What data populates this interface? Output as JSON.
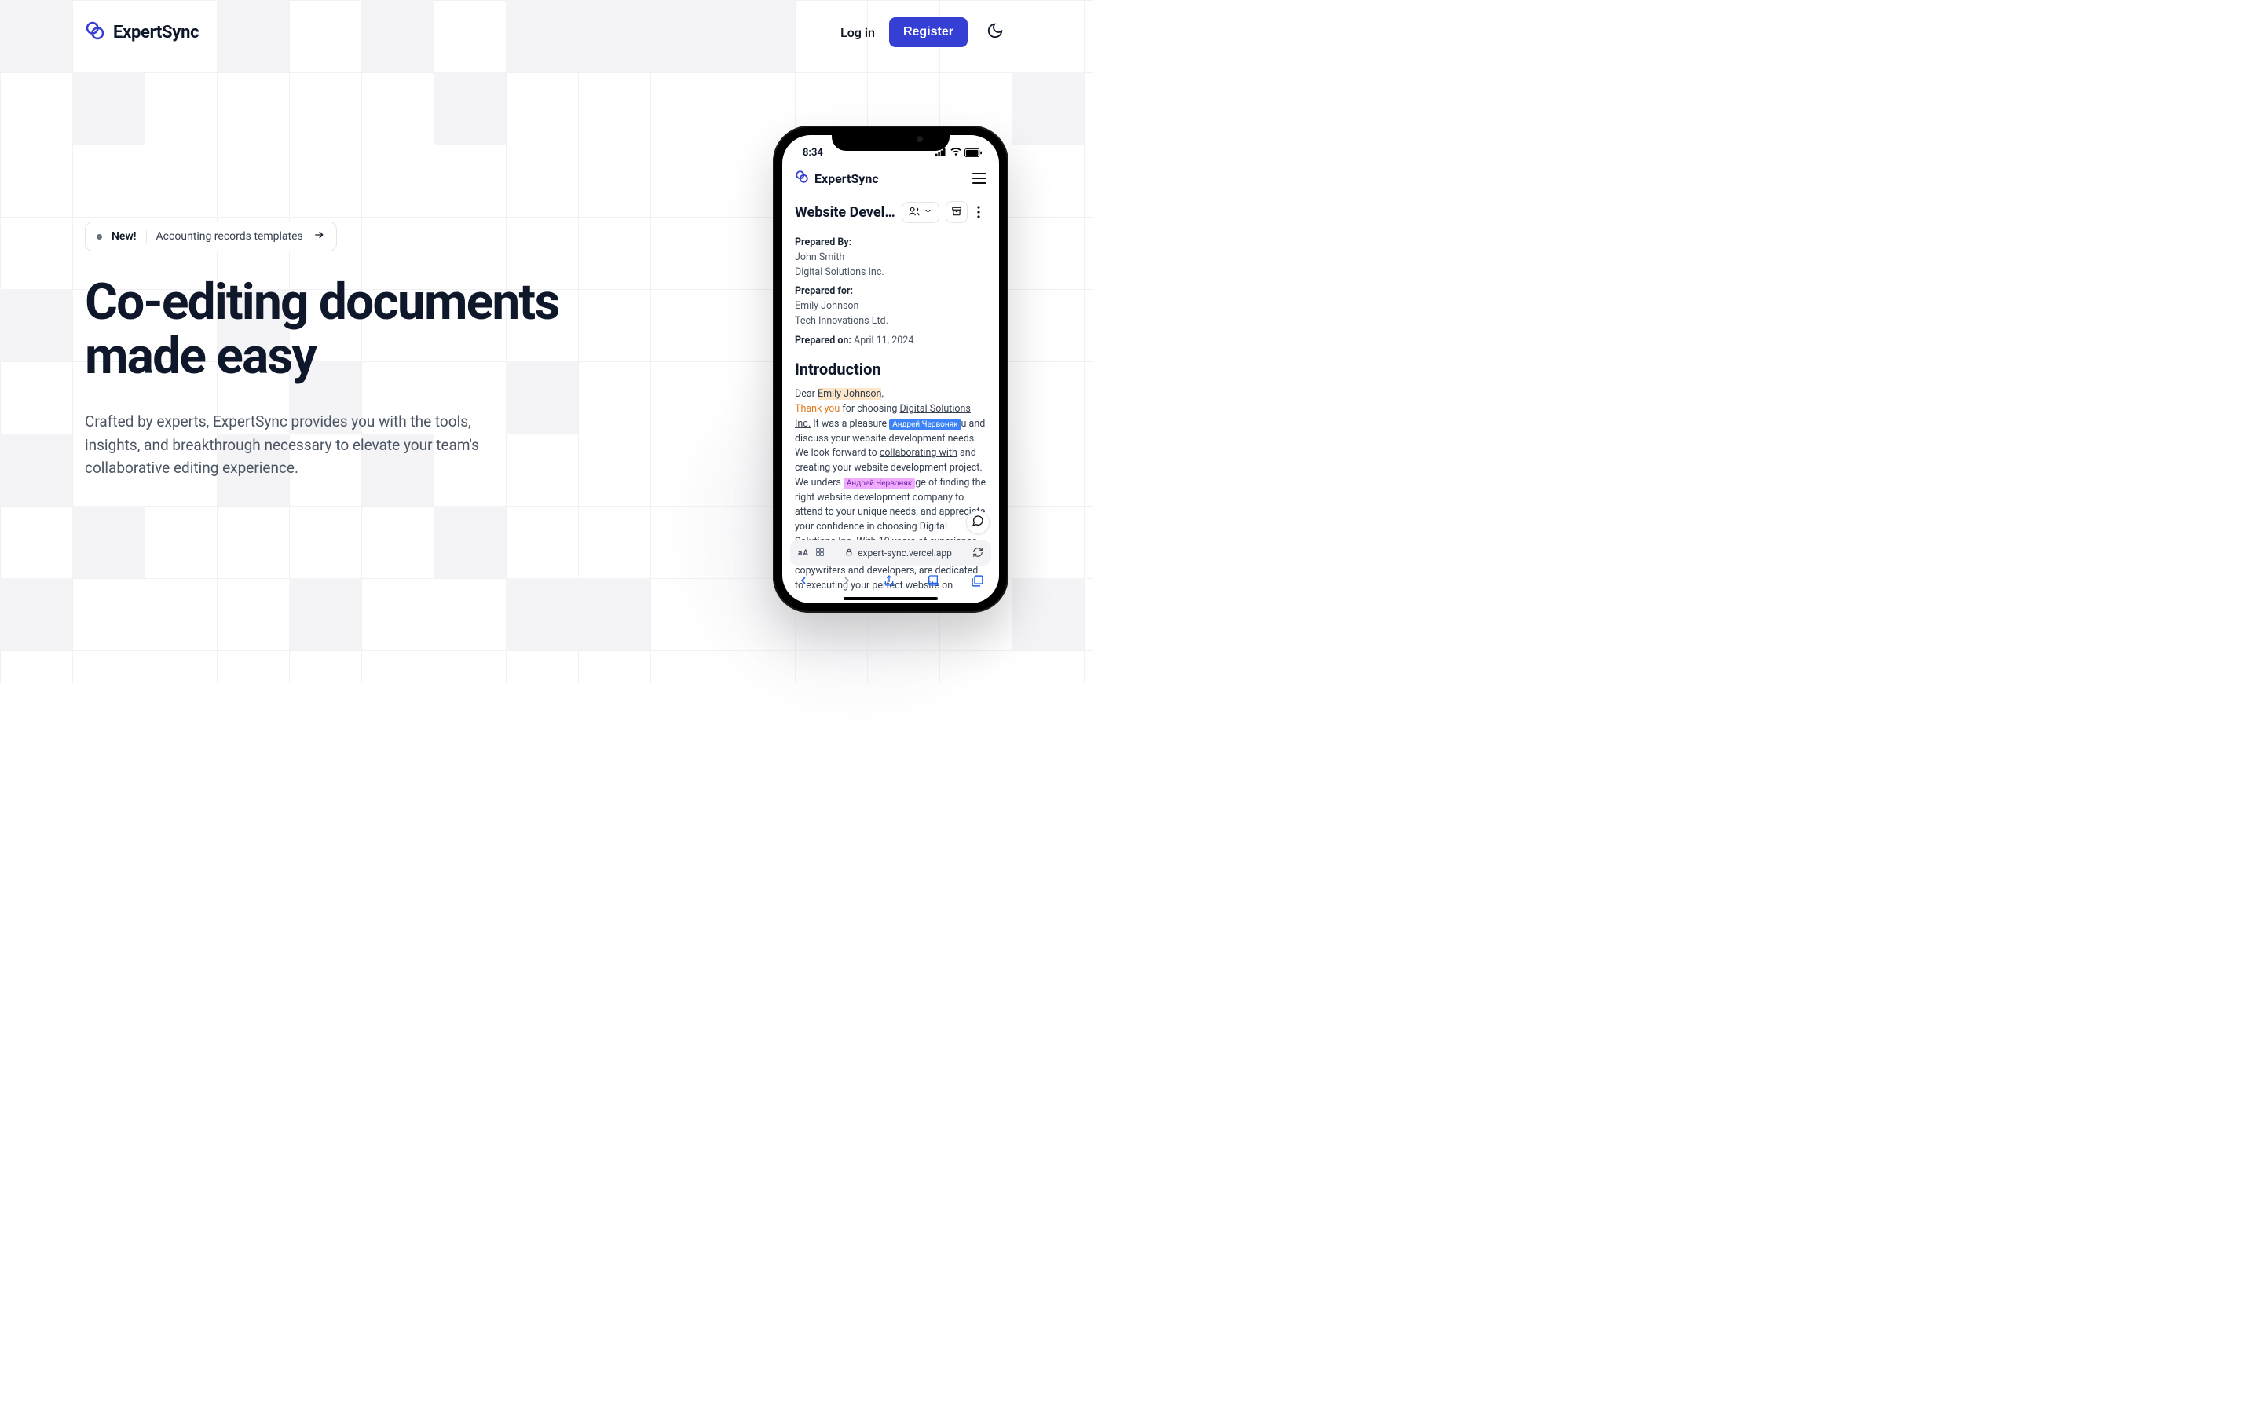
{
  "brand": {
    "name": "ExpertSync"
  },
  "header": {
    "login": "Log in",
    "register": "Register"
  },
  "pill": {
    "new": "New!",
    "desc": "Accounting records templates"
  },
  "hero": {
    "headline": "Co-editing documents made easy",
    "sub": "Crafted by experts, ExpertSync provides you with the tools, insights, and breakthrough necessary to elevate your team's collaborative editing experience."
  },
  "phone": {
    "status_time": "8:34",
    "app_brand": "ExpertSync",
    "doc_title": "Website Devel…",
    "safari_url": "expert-sync.vercel.app",
    "prepared_by_label": "Prepared By:",
    "prepared_by_name": "John Smith",
    "prepared_by_company": "Digital Solutions Inc.",
    "prepared_for_label": "Prepared for:",
    "prepared_for_name": "Emily Johnson",
    "prepared_for_company": "Tech Innovations Ltd.",
    "prepared_on_label": "Prepared on:",
    "prepared_on_value": "April 11, 2024",
    "intro_heading": "Introduction",
    "dear": "Dear ",
    "emily": "Emily Johnson",
    "comma": ",",
    "thank_you": "Thank you",
    "para1_a": " for choosing ",
    "company_underlined": "Digital Solutions Inc.",
    "para1_b": " It was a pleasure",
    "collab_tag_1": "Андрей Червоняк",
    "para1_c": "u and discuss your website development needs. We look forward to ",
    "collab_underlined": "collaborating with",
    "para1_d": " and creating your website development project. We unders",
    "collab_tag_2": "Андрей Червоняк",
    "para1_e": "ge of finding the right website development company to attend to your unique needs, and appreciate your confidence in choosing Digital Solutions Inc. With 10 years of experience and an exceptional in-ho     team of designers, copywriters and developers,      are dedicated to executing your perfect website on"
  },
  "colors": {
    "accent": "#363FD3"
  }
}
